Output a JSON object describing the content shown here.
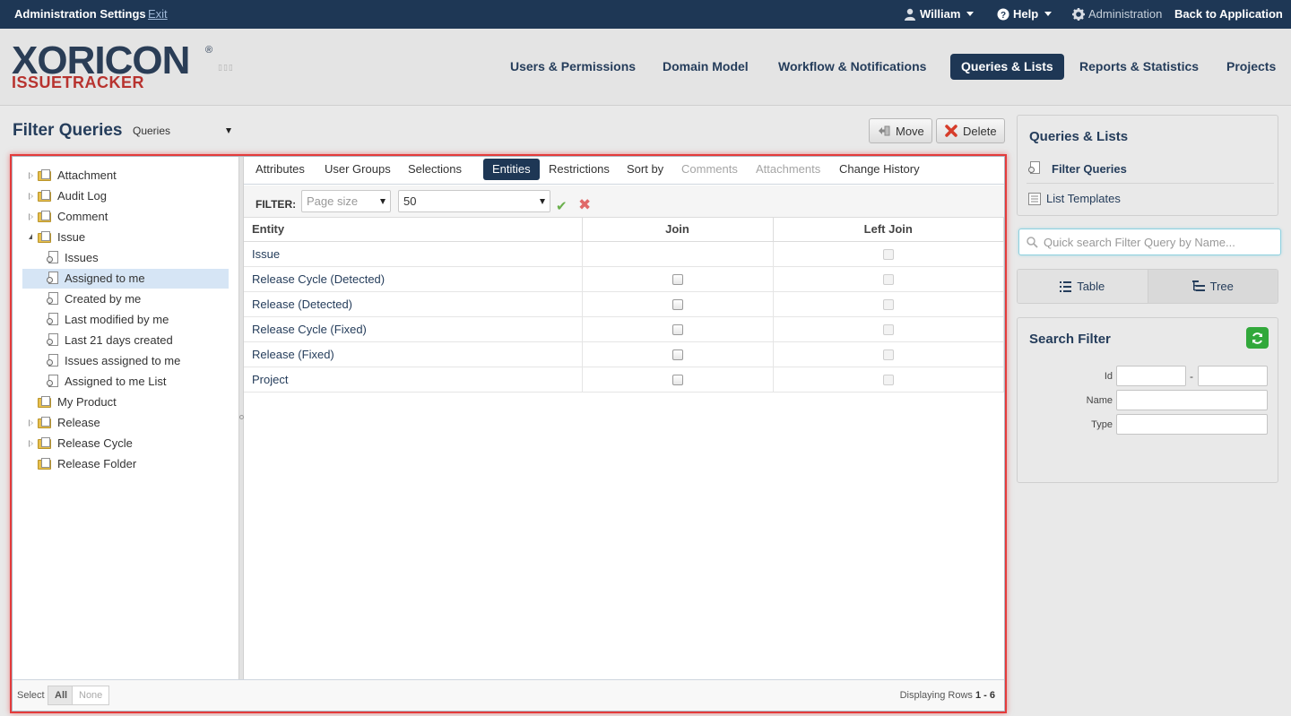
{
  "topbar": {
    "title": "Administration Settings",
    "exit": "Exit",
    "user": "William",
    "help": "Help",
    "administration": "Administration",
    "back": "Back to Application"
  },
  "logo": {
    "brand": "XORICON",
    "registered": "®",
    "product": "ISSUETRACKER"
  },
  "nav": [
    "Users & Permissions",
    "Domain Model",
    "Workflow & Notifications",
    "Queries & Lists",
    "Reports & Statistics",
    "Projects"
  ],
  "nav_active": "Queries & Lists",
  "page": {
    "title": "Filter Queries",
    "query_type": "Queries",
    "move": "Move",
    "delete": "Delete"
  },
  "tree": [
    {
      "label": "Attachment",
      "level": 0,
      "state": "closed",
      "icon": "folder-icon"
    },
    {
      "label": "Audit Log",
      "level": 0,
      "state": "closed",
      "icon": "folder-icon"
    },
    {
      "label": "Comment",
      "level": 0,
      "state": "closed",
      "icon": "folder-icon"
    },
    {
      "label": "Issue",
      "level": 0,
      "state": "open",
      "icon": "folder-icon"
    },
    {
      "label": "Issues",
      "level": 1,
      "icon": "query-icon"
    },
    {
      "label": "Assigned to me",
      "level": 1,
      "icon": "query-icon",
      "selected": true
    },
    {
      "label": "Created by me",
      "level": 1,
      "icon": "query-icon"
    },
    {
      "label": "Last modified by me",
      "level": 1,
      "icon": "query-icon"
    },
    {
      "label": "Last 21 days created",
      "level": 1,
      "icon": "query-icon"
    },
    {
      "label": "Issues assigned to me",
      "level": 1,
      "icon": "query-icon"
    },
    {
      "label": "Assigned to me List",
      "level": 1,
      "icon": "query-icon"
    },
    {
      "label": "My Product",
      "level": 0,
      "state": "none",
      "icon": "folder-icon"
    },
    {
      "label": "Release",
      "level": 0,
      "state": "closed",
      "icon": "folder-icon"
    },
    {
      "label": "Release Cycle",
      "level": 0,
      "state": "closed",
      "icon": "folder-icon"
    },
    {
      "label": "Release Folder",
      "level": 0,
      "state": "none",
      "icon": "folder-icon"
    }
  ],
  "tabs": [
    {
      "label": "Attributes"
    },
    {
      "label": "User Groups"
    },
    {
      "label": "Selections"
    },
    {
      "label": "Entities",
      "active": true
    },
    {
      "label": "Restrictions"
    },
    {
      "label": "Sort by"
    },
    {
      "label": "Comments",
      "disabled": true
    },
    {
      "label": "Attachments",
      "disabled": true
    },
    {
      "label": "Change History"
    }
  ],
  "filter": {
    "label": "FILTER:",
    "page_size_placeholder": "Page size",
    "page_size_value": "50"
  },
  "grid": {
    "columns": [
      "Entity",
      "Join",
      "Left Join"
    ],
    "rows": [
      {
        "entity": "Issue",
        "join": null,
        "left_join": false
      },
      {
        "entity": "Release Cycle (Detected)",
        "join": false,
        "left_join": false
      },
      {
        "entity": "Release (Detected)",
        "join": false,
        "left_join": false
      },
      {
        "entity": "Release Cycle (Fixed)",
        "join": false,
        "left_join": false
      },
      {
        "entity": "Release (Fixed)",
        "join": false,
        "left_join": false
      },
      {
        "entity": "Project",
        "join": false,
        "left_join": false
      }
    ]
  },
  "footer": {
    "select": "Select",
    "all": "All",
    "none": "None",
    "rows_prefix": "Displaying Rows",
    "rows_range": "1 - 6"
  },
  "sidebar": {
    "panel_title": "Queries & Lists",
    "links": [
      "Filter Queries",
      "List Templates"
    ],
    "search_placeholder": "Quick search Filter Query by Name...",
    "view_table": "Table",
    "view_tree": "Tree",
    "search_filter_title": "Search Filter",
    "fields": {
      "id": "Id",
      "dash": "-",
      "name": "Name",
      "type": "Type"
    }
  }
}
